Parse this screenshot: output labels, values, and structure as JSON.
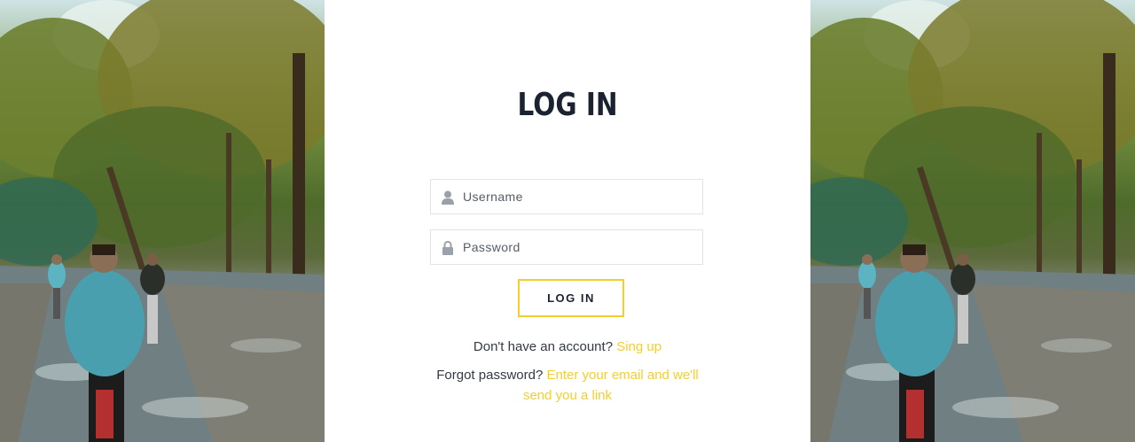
{
  "login": {
    "title": "LOG IN",
    "username_placeholder": "Username",
    "password_placeholder": "Password",
    "submit_label": "LOG IN",
    "signup_prompt": "Don't have an account?",
    "signup_link": "Sing up",
    "forgot_prompt": "Forgot password?",
    "forgot_link": "Enter your email and we'll send you a link"
  },
  "icons": {
    "username": "user-icon",
    "password": "lock-icon"
  },
  "colors": {
    "accent": "#f2cf2f",
    "title": "#1b2230",
    "text": "#333a44",
    "border": "#e3e3e3"
  }
}
